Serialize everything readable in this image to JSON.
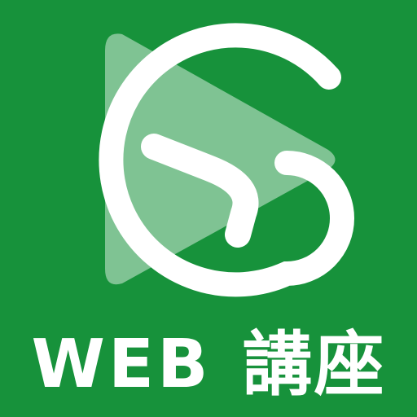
{
  "app_icon": {
    "background_color": "#17923b",
    "mark_color": "#ffffff",
    "play_triangle_color": "rgba(255,255,255,0.45)",
    "icon_names": [
      "play-triangle-icon",
      "ring-g-mark-icon",
      "letter-n-mark-icon"
    ],
    "caption_latin": "WEB",
    "caption_cjk": "講座"
  }
}
